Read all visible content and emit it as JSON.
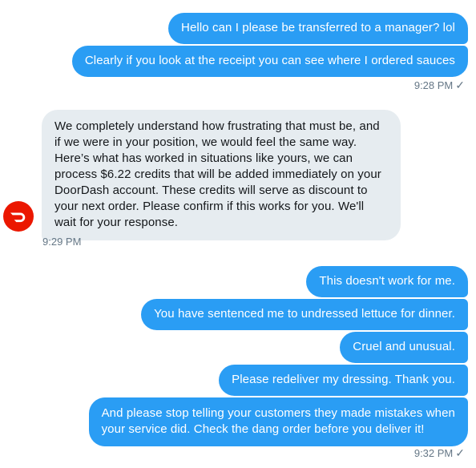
{
  "messages": {
    "m1": "Hello can I please be transferred to a manager? lol",
    "m2": "Clearly if you look at the receipt you can see where I ordered sauces",
    "time1": "9:28 PM",
    "reply_lines": [
      "We completely understand how frustrating that must be, and",
      "if we were in your position, we would feel the same way.",
      "Here’s what has worked in situations like yours, we can",
      "process $6.22 credits that will be added immediately on your",
      "DoorDash account. These credits will serve as discount to",
      "your next order. Please confirm if this works for you. We'll",
      "wait for your response."
    ],
    "time2": "9:29 PM",
    "m3": "This doesn't work for me.",
    "m4": "You have sentenced me to undressed lettuce for dinner.",
    "m5": "Cruel and unusual.",
    "m6": "Please redeliver my dressing. Thank you.",
    "m7_lines": [
      "And please stop telling your customers they made mistakes when",
      "your service did. Check the dang order before you deliver it!"
    ],
    "time3": "9:32 PM"
  },
  "icons": {
    "avatar": "doordash-logo-icon",
    "read": "checkmark-icon"
  },
  "colors": {
    "outgoing_bubble": "#2a9df4",
    "incoming_bubble": "#e6ecf0",
    "brand": "#eb1700"
  }
}
